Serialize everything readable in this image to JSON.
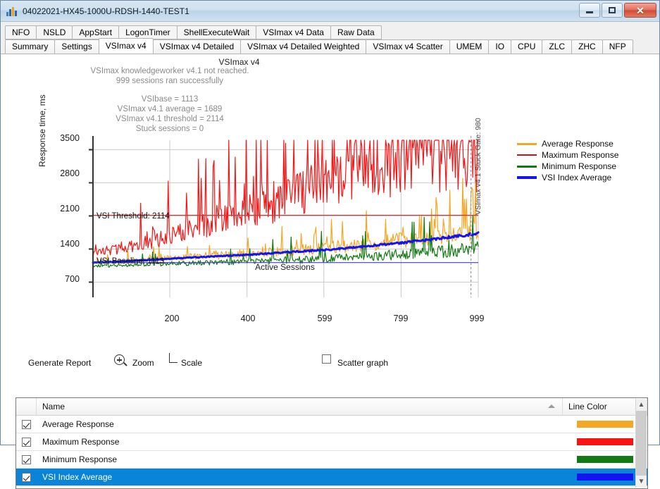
{
  "window": {
    "title": "04022021-HX45-1000U-RDSH-1440-TEST1",
    "icon": "bar-chart-icon",
    "minimize": "–",
    "maximize": "□",
    "close": "✕"
  },
  "tabs_row1": [
    {
      "label": "NFO",
      "selected": false
    },
    {
      "label": "NSLD",
      "selected": false
    },
    {
      "label": "AppStart",
      "selected": false
    },
    {
      "label": "LogonTimer",
      "selected": false
    },
    {
      "label": "ShellExecuteWait",
      "selected": false
    },
    {
      "label": "VSImax v4 Data",
      "selected": false
    },
    {
      "label": "Raw Data",
      "selected": false
    }
  ],
  "tabs_row2": [
    {
      "label": "Summary",
      "selected": false
    },
    {
      "label": "Settings",
      "selected": false
    },
    {
      "label": "VSImax v4",
      "selected": true
    },
    {
      "label": "VSImax v4 Detailed",
      "selected": false
    },
    {
      "label": "VSImax v4 Detailed Weighted",
      "selected": false
    },
    {
      "label": "VSImax v4 Scatter",
      "selected": false
    },
    {
      "label": "UMEM",
      "selected": false
    },
    {
      "label": "IO",
      "selected": false
    },
    {
      "label": "CPU",
      "selected": false
    },
    {
      "label": "ZLC",
      "selected": false
    },
    {
      "label": "ZHC",
      "selected": false
    },
    {
      "label": "NFP",
      "selected": false
    }
  ],
  "toolbar": {
    "generate_report": "Generate Report",
    "zoom": "Zoom",
    "scale": "Scale",
    "scatter_graph": "Scatter graph",
    "scatter_checked": false
  },
  "grid": {
    "columns": [
      "",
      "Name",
      "Line Color"
    ],
    "rows": [
      {
        "checked": true,
        "name": "Average Response",
        "color": "#f5a623",
        "selected": false
      },
      {
        "checked": true,
        "name": "Maximum Response",
        "color": "#f81414",
        "selected": false
      },
      {
        "checked": true,
        "name": "Minimum Response",
        "color": "#127a12",
        "selected": false
      },
      {
        "checked": true,
        "name": "VSI Index Average",
        "color": "#1414f0",
        "selected": true
      }
    ]
  },
  "chart_data": {
    "type": "line",
    "title": "VSImax v4",
    "xlabel": "Active Sessions",
    "ylabel": "Response time, ms",
    "xlim": [
      1,
      999
    ],
    "ylim": [
      200,
      3700
    ],
    "xticks": [
      200,
      400,
      599,
      799,
      999
    ],
    "yticks": [
      700,
      1400,
      2100,
      2800,
      3500
    ],
    "grid": true,
    "legend_position": "right",
    "annotations": {
      "headline1": "VSImax knowledgeworker v4.1 not reached.",
      "headline2": "999 sessions ran successfully",
      "stat1": "VSIbase = 1113",
      "stat2": "VSImax v4.1 average = 1689",
      "stat3": "VSImax v4.1 threshold = 2114",
      "stat4": "Stuck sessions = 0",
      "threshold_label": "VSI Threshold: 2114",
      "baseline_label": "VSI Baseline: 1113",
      "stuck_gate_label": "VSImax v4.1 Stuck Gate: 980"
    },
    "reference_lines": [
      {
        "name": "VSI Threshold",
        "value": 2114,
        "color": "#c04040",
        "orientation": "horizontal"
      },
      {
        "name": "VSI Baseline",
        "value": 1113,
        "color": "#4040c0",
        "orientation": "horizontal"
      },
      {
        "name": "Stuck Gate",
        "value": 980,
        "color": "#9a9a9a",
        "orientation": "vertical",
        "style": "dashed"
      }
    ],
    "series": [
      {
        "name": "Average Response",
        "color": "#f5a623",
        "x": [
          1,
          50,
          100,
          150,
          200,
          250,
          300,
          350,
          400,
          450,
          500,
          550,
          600,
          650,
          700,
          750,
          800,
          850,
          900,
          950,
          999
        ],
        "values": [
          1120,
          1135,
          1160,
          1180,
          1210,
          1235,
          1255,
          1280,
          1300,
          1330,
          1360,
          1395,
          1420,
          1455,
          1500,
          1545,
          1590,
          1640,
          1690,
          1745,
          1800
        ]
      },
      {
        "name": "Maximum Response",
        "color": "#f81414",
        "x": [
          1,
          50,
          100,
          150,
          200,
          250,
          300,
          350,
          400,
          450,
          500,
          550,
          600,
          650,
          700,
          750,
          800,
          850,
          900,
          950,
          999
        ],
        "values": [
          1310,
          1380,
          1470,
          1560,
          1690,
          1810,
          1900,
          2050,
          2180,
          2300,
          2450,
          2600,
          2750,
          2900,
          3050,
          3180,
          3300,
          3400,
          3480,
          3540,
          3600
        ]
      },
      {
        "name": "Minimum Response",
        "color": "#127a12",
        "x": [
          1,
          50,
          100,
          150,
          200,
          250,
          300,
          350,
          400,
          450,
          500,
          550,
          600,
          650,
          700,
          750,
          800,
          850,
          900,
          950,
          999
        ],
        "values": [
          1040,
          1050,
          1065,
          1075,
          1090,
          1100,
          1110,
          1125,
          1135,
          1150,
          1165,
          1180,
          1195,
          1215,
          1235,
          1260,
          1285,
          1310,
          1340,
          1375,
          1410
        ]
      },
      {
        "name": "VSI Index Average",
        "color": "#1414f0",
        "x": [
          1,
          50,
          100,
          150,
          200,
          250,
          300,
          350,
          400,
          450,
          500,
          550,
          600,
          650,
          700,
          750,
          800,
          850,
          900,
          950,
          999
        ],
        "values": [
          1113,
          1128,
          1150,
          1168,
          1195,
          1218,
          1238,
          1258,
          1278,
          1302,
          1328,
          1358,
          1382,
          1412,
          1452,
          1492,
          1532,
          1578,
          1625,
          1678,
          1730
        ]
      }
    ]
  }
}
